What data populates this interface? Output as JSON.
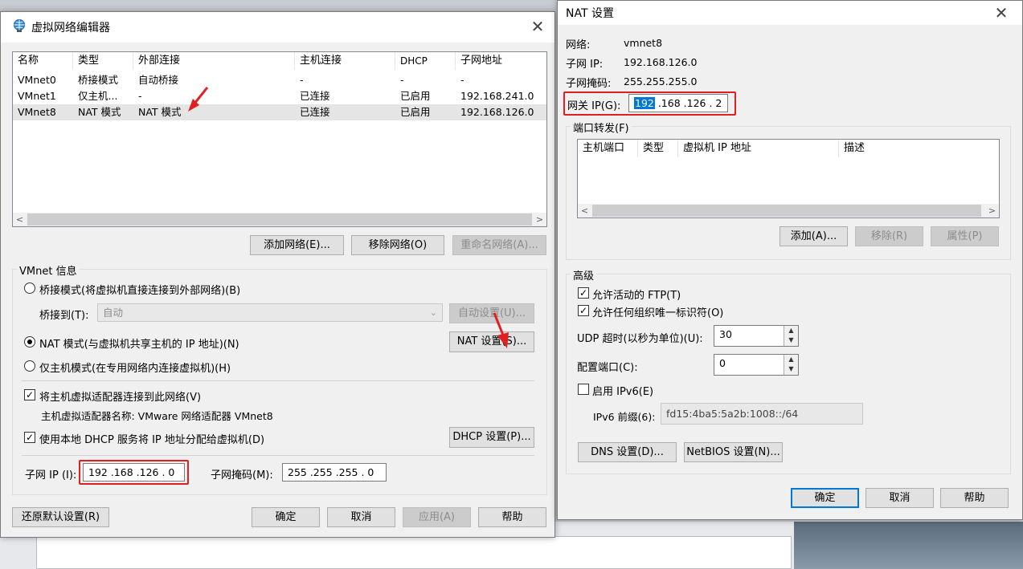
{
  "vne": {
    "title": "虚拟网络编辑器",
    "columns": [
      "名称",
      "类型",
      "外部连接",
      "主机连接",
      "DHCP",
      "子网地址"
    ],
    "rows": [
      [
        "VMnet0",
        "桥接模式",
        "自动桥接",
        "-",
        "-",
        "-"
      ],
      [
        "VMnet1",
        "仅主机...",
        "-",
        "已连接",
        "已启用",
        "192.168.241.0"
      ],
      [
        "VMnet8",
        "NAT 模式",
        "NAT 模式",
        "已连接",
        "已启用",
        "192.168.126.0"
      ]
    ],
    "add_network": "添加网络(E)...",
    "remove_network": "移除网络(O)",
    "rename_network": "重命名网络(A)...",
    "info_label": "VMnet 信息",
    "bridge_mode": "桥接模式(将虚拟机直接连接到外部网络)(B)",
    "bridge_to_label": "桥接到(T):",
    "bridge_to_value": "自动",
    "auto_settings": "自动设置(U)...",
    "nat_mode": "NAT 模式(与虚拟机共享主机的 IP 地址)(N)",
    "nat_settings": "NAT 设置(S)...",
    "host_only": "仅主机模式(在专用网络内连接虚拟机)(H)",
    "connect_adapter": "将主机虚拟适配器连接到此网络(V)",
    "adapter_name": "主机虚拟适配器名称: VMware 网络适配器 VMnet8",
    "use_dhcp": "使用本地 DHCP 服务将 IP 地址分配给虚拟机(D)",
    "dhcp_settings": "DHCP 设置(P)...",
    "subnet_ip_label": "子网 IP (I):",
    "subnet_ip": "192 .168 .126 .  0",
    "subnet_mask_label": "子网掩码(M):",
    "subnet_mask": "255 .255 .255 .  0",
    "restore": "还原默认设置(R)",
    "ok": "确定",
    "cancel": "取消",
    "apply": "应用(A)",
    "help": "帮助"
  },
  "nat": {
    "title": "NAT 设置",
    "network_label": "网络:",
    "network_value": "vmnet8",
    "subnet_ip_label": "子网 IP:",
    "subnet_ip_value": "192.168.126.0",
    "subnet_mask_label": "子网掩码:",
    "subnet_mask_value": "255.255.255.0",
    "gateway_label": "网关 IP(G):",
    "gateway_sel": "192",
    "gateway_rest": " .168 .126 .  2",
    "port_forward_label": "端口转发(F)",
    "pf_columns": [
      "主机端口",
      "类型",
      "虚拟机 IP 地址",
      "描述"
    ],
    "add": "添加(A)...",
    "remove": "移除(R)",
    "properties": "属性(P)",
    "advanced_label": "高级",
    "allow_ftp": "允许活动的 FTP(T)",
    "allow_oui": "允许任何组织唯一标识符(O)",
    "udp_timeout_label": "UDP 超时(以秒为单位)(U):",
    "udp_timeout_value": "30",
    "config_port_label": "配置端口(C):",
    "config_port_value": "0",
    "enable_ipv6": "启用 IPv6(E)",
    "ipv6_prefix_label": "IPv6 前缀(6):",
    "ipv6_prefix_value": "fd15:4ba5:5a2b:1008::/64",
    "dns_settings": "DNS 设置(D)...",
    "netbios_settings": "NetBIOS 设置(N)...",
    "ok": "确定",
    "cancel": "取消",
    "help": "帮助"
  },
  "colors": {
    "accent": "#0078d7",
    "highlight": "#e02020"
  }
}
